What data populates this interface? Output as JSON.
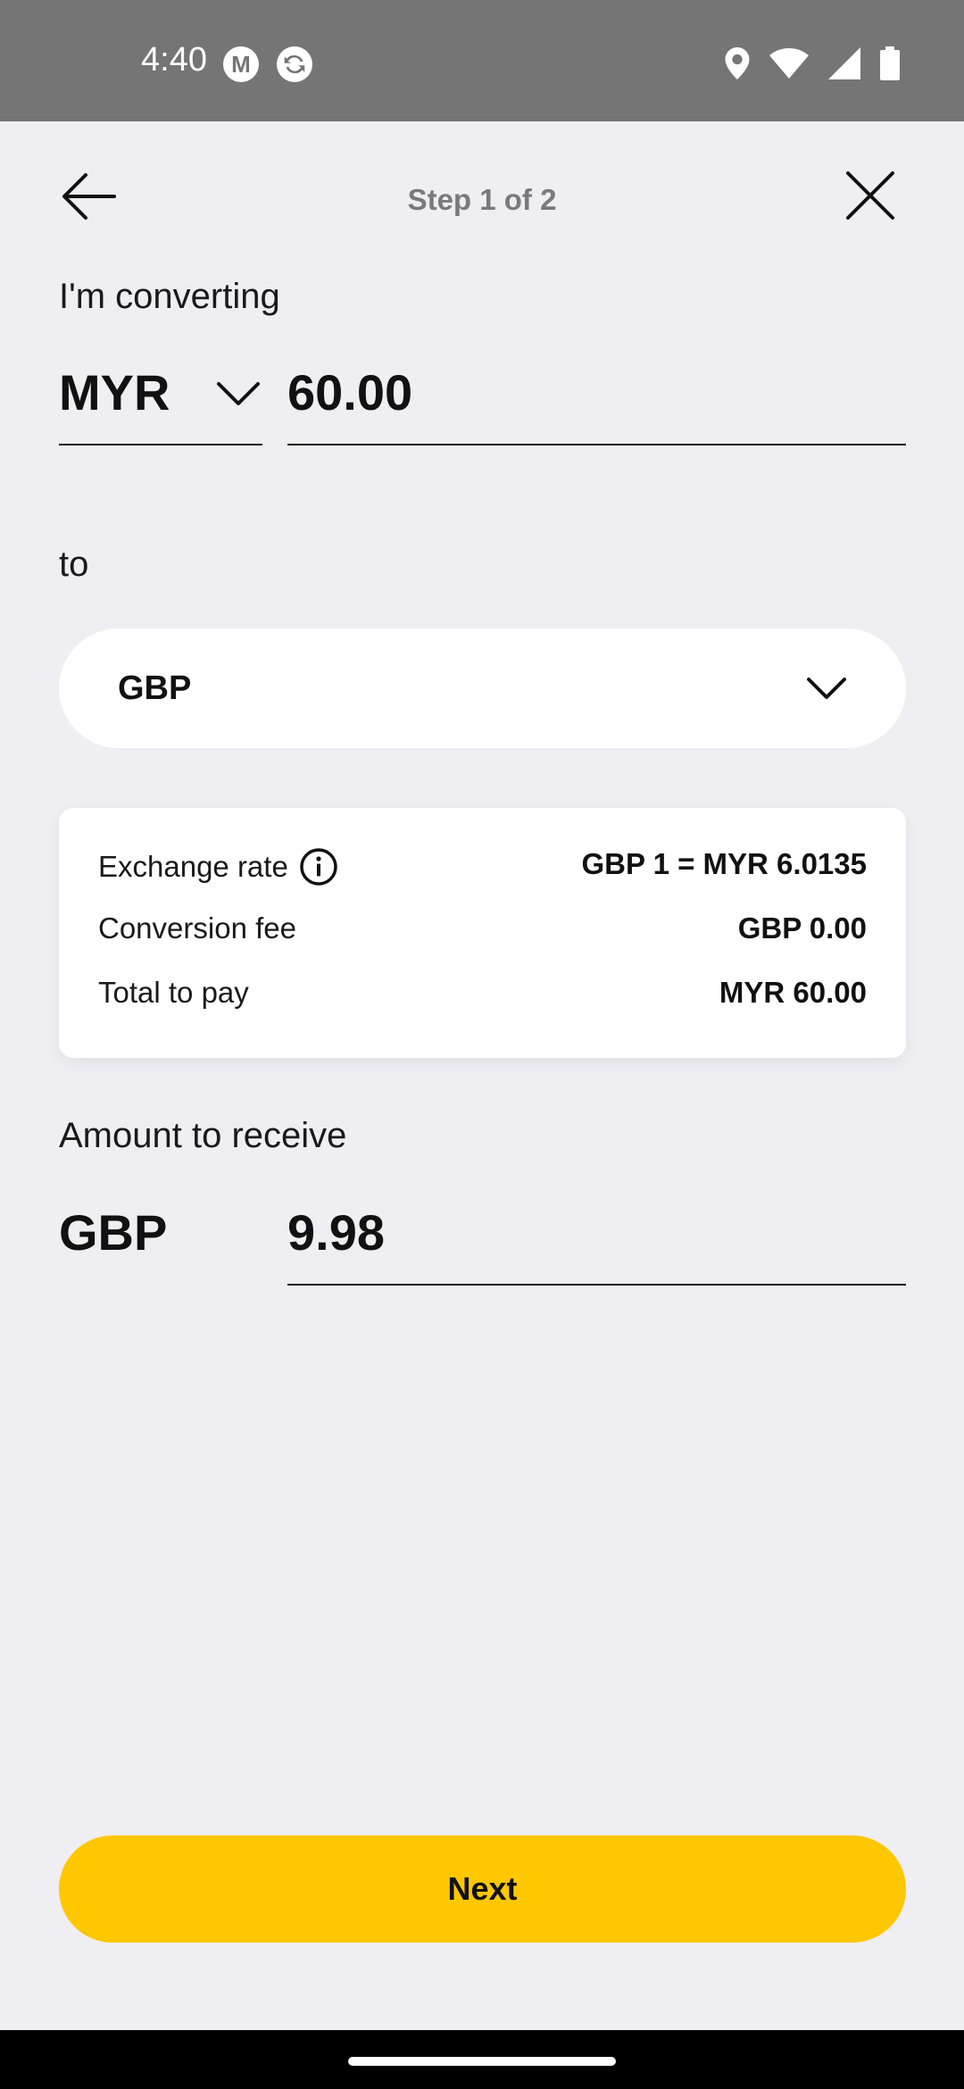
{
  "status_bar": {
    "time": "4:40",
    "left_icons": [
      "m-app-icon",
      "sync-app-icon"
    ],
    "right_icons": [
      "location-icon",
      "wifi-icon",
      "signal-icon",
      "battery-icon"
    ]
  },
  "header": {
    "step": "Step 1 of 2",
    "back_icon": "arrow-left-icon",
    "close_icon": "close-icon"
  },
  "converting": {
    "label": "I'm converting",
    "currency": "MYR",
    "amount": "60.00"
  },
  "target": {
    "label": "to",
    "currency": "GBP"
  },
  "rate_card": {
    "rows": [
      {
        "label": "Exchange rate",
        "value": "GBP 1 = MYR 6.0135",
        "info": true
      },
      {
        "label": "Conversion fee",
        "value": "GBP 0.00"
      },
      {
        "label": "Total to pay",
        "value": "MYR 60.00"
      }
    ]
  },
  "receive": {
    "label": "Amount to receive",
    "currency": "GBP",
    "amount": "9.98"
  },
  "actions": {
    "next_label": "Next"
  },
  "colors": {
    "background": "#efeef3",
    "accent": "#ffc700",
    "status_bar": "#757575"
  }
}
